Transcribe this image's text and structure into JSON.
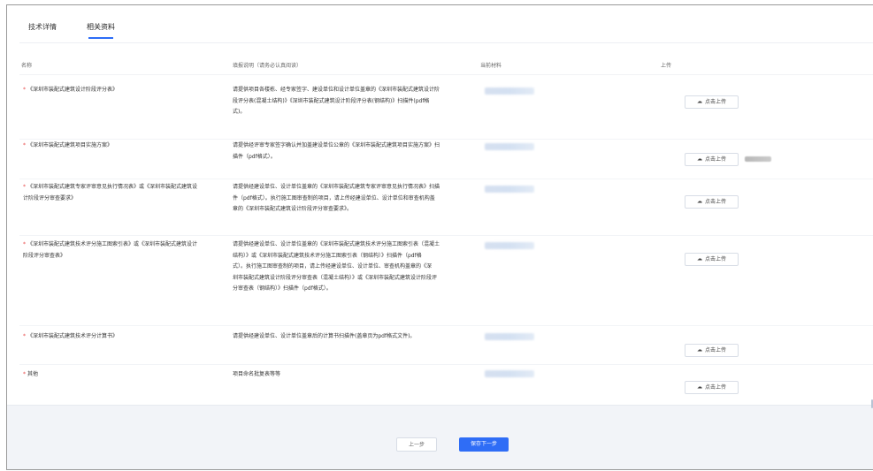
{
  "tabs": [
    {
      "label": "技术详情"
    },
    {
      "label": "相关资料"
    }
  ],
  "table": {
    "headers": {
      "name": "名称",
      "description": "填报说明（请务必认真阅读）",
      "current": "当前材料",
      "upload": "上传"
    },
    "rows": [
      {
        "name": "《深圳市装配式建筑设计阶段评分表》",
        "required_mark": "*",
        "description": [
          "请提供项目各楼栋、经专家签字、建设单位和设计单位盖章的《深圳市装配式建筑设计阶",
          "段评分表(混凝土结构)》《深圳市装配式建筑设计阶段评分表(钢结构)》扫描件(pdf格",
          "式)。"
        ],
        "upload_label": "点击上传"
      },
      {
        "name": "《深圳市装配式建筑项目实施方案》",
        "required_mark": "*",
        "description": [
          "请提供经评审专家签字确认并加盖建设单位公章的《深圳市装配式建筑项目实施方案》扫",
          "描件（pdf格式）。"
        ],
        "upload_label": "点击上传"
      },
      {
        "name": [
          "《深圳市装配式建筑专家评审意见执行情况表》或《深圳市装配式建筑设",
          "计阶段评分审查要求》"
        ],
        "required_mark": "*",
        "description": [
          "请提供经建设单位、设计单位盖章的《深圳市装配式建筑专家评审意见执行情况表》扫描",
          "件（pdf格式）。执行施工图审查制的项目，请上传经建设单位、设计单位和审查机构盖",
          "章的《深圳市装配式建筑设计阶段评分审查要求》。"
        ],
        "upload_label": "点击上传"
      },
      {
        "name": [
          "《深圳市装配式建筑技术评分施工图索引表》或《深圳市装配式建筑设计",
          "阶段评分审查表》"
        ],
        "required_mark": "*",
        "description": [
          "请提供经建设单位、设计单位盖章的《深圳市装配式建筑技术评分施工图索引表（混凝土",
          "结构）》或《深圳市装配式建筑技术评分施工图索引表（钢结构）》扫描件（pdf格",
          "式）。执行施工图审查制的项目，请上传经建设单位、设计单位、审查机构盖章的《深",
          "圳市装配式建筑设计阶段评分审查表（混凝土结构）》或《深圳市装配式建筑设计阶段评",
          "分审查表（钢结构）》扫描件（pdf格式）。"
        ],
        "upload_label": "点击上传"
      },
      {
        "name": "《深圳市装配式建筑技术评分计算书》",
        "required_mark": "*",
        "description": [
          "请提供经建设单位、设计单位盖章后的计算书扫描件(盖章页为pdf格式文件)。"
        ],
        "upload_label": "点击上传"
      },
      {
        "name": "其他",
        "required_mark": "*",
        "description": [
          "项目命名批复表等等"
        ],
        "upload_label": "点击上传"
      }
    ]
  },
  "actions": {
    "prev_label": "上一步",
    "next_label": "保存下一步"
  },
  "colors": {
    "accent": "#2f6df6",
    "required": "#e84a4a",
    "background_bottom": "#f2f4f8"
  },
  "icons": {
    "upload": "cloud-upload-icon"
  }
}
